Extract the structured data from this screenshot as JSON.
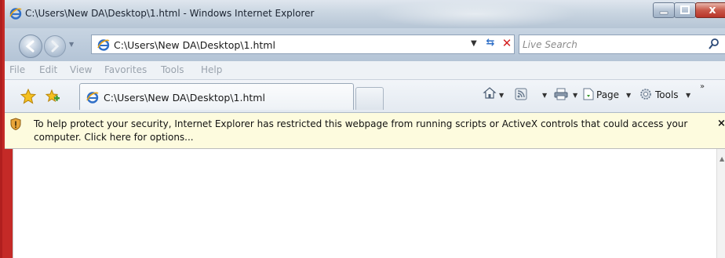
{
  "window": {
    "title": "C:\\Users\\New DA\\Desktop\\1.html - Windows Internet Explorer",
    "minimize_icon": "minimize-icon",
    "maximize_icon": "maximize-icon",
    "close_label": "x"
  },
  "address_bar": {
    "url": "C:\\Users\\New DA\\Desktop\\1.html",
    "search_placeholder": "Live Search"
  },
  "menu": {
    "items": [
      "File",
      "Edit",
      "View",
      "Favorites",
      "Tools",
      "Help"
    ]
  },
  "tabs": {
    "active_label": "C:\\Users\\New DA\\Desktop\\1.html"
  },
  "command_bar": {
    "page_label": "Page",
    "tools_label": "Tools"
  },
  "info_bar": {
    "message": "To help protect your security, Internet Explorer has restricted this webpage from running scripts or ActiveX controls that could access your computer. Click here for options...",
    "close_label": "×"
  },
  "colors": {
    "frame": "#c42a27",
    "info_bar_bg": "#fdfbde",
    "ie_blue": "#2f6fc7"
  }
}
